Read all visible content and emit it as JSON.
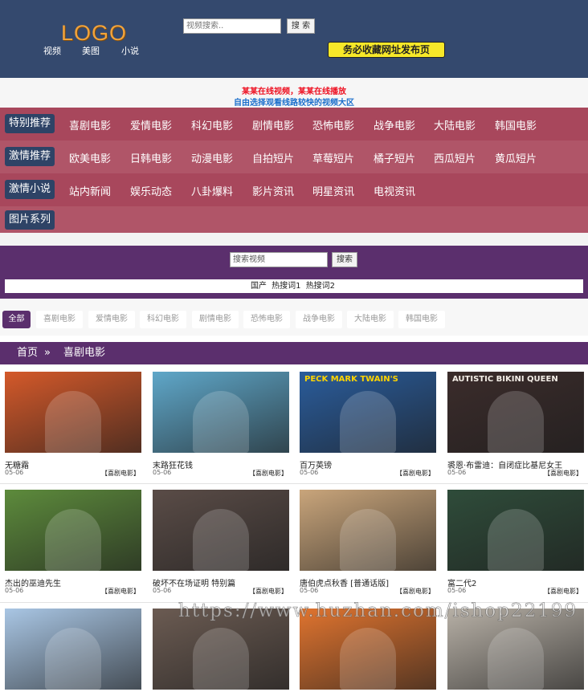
{
  "header": {
    "logo": "LOGO",
    "nav": [
      "视频",
      "美图",
      "小说"
    ],
    "search_placeholder": "视频搜索..",
    "search_button": "搜 索",
    "publish_banner": "务必收藏网址发布页"
  },
  "notice": {
    "line1": "某某在线视频，某某在线播放",
    "line2": "自由选择观看线路较快的视频大区"
  },
  "menu": [
    {
      "head": "特别推荐",
      "items": [
        "喜剧电影",
        "爱情电影",
        "科幻电影",
        "剧情电影",
        "恐怖电影",
        "战争电影",
        "大陆电影",
        "韩国电影"
      ]
    },
    {
      "head": "激情推荐",
      "items": [
        "欧美电影",
        "日韩电影",
        "动漫电影",
        "自拍短片",
        "草莓短片",
        "橘子短片",
        "西瓜短片",
        "黄瓜短片"
      ]
    },
    {
      "head": "激情小说",
      "items": [
        "站内新闻",
        "娱乐动态",
        "八卦爆料",
        "影片资讯",
        "明星资讯",
        "电视资讯"
      ]
    },
    {
      "head": "图片系列",
      "items": []
    }
  ],
  "search2": {
    "placeholder": "搜索视频",
    "button": "搜索",
    "hot": [
      "国产",
      "热搜词1",
      "热搜词2"
    ]
  },
  "filters": {
    "all": "全部",
    "tabs": [
      "喜剧电影",
      "爱情电影",
      "科幻电影",
      "剧情电影",
      "恐怖电影",
      "战争电影",
      "大陆电影",
      "韩国电影"
    ]
  },
  "breadcrumb": {
    "home": "首页",
    "separator": "»",
    "current": "喜剧电影"
  },
  "videos": [
    {
      "title": "无糖霜",
      "date": "05-06",
      "tag": "【喜剧电影】"
    },
    {
      "title": "末路狂花钱",
      "date": "05-06",
      "tag": "【喜剧电影】"
    },
    {
      "title": "百万英镑",
      "date": "05-06",
      "tag": "【喜剧电影】"
    },
    {
      "title": "裘恩·布雷迪：自闭症比基尼女王",
      "date": "05-06",
      "tag": "【喜剧电影】"
    },
    {
      "title": "杰出的巫迪先生",
      "date": "05-06",
      "tag": "【喜剧电影】"
    },
    {
      "title": "破坏不在场证明 特别篇",
      "date": "05-06",
      "tag": "【喜剧电影】"
    },
    {
      "title": "唐伯虎点秋香 [普通话版]",
      "date": "05-06",
      "tag": "【喜剧电影】"
    },
    {
      "title": "富二代2",
      "date": "05-06",
      "tag": "【喜剧电影】"
    },
    {
      "title": "",
      "date": "",
      "tag": ""
    },
    {
      "title": "",
      "date": "",
      "tag": ""
    },
    {
      "title": "",
      "date": "",
      "tag": ""
    },
    {
      "title": "",
      "date": "",
      "tag": ""
    }
  ],
  "posters": [
    {
      "bg": "#d4592a"
    },
    {
      "bg": "#5fa7c9",
      "caption": ""
    },
    {
      "bg": "#2a5c9b",
      "caption": "PECK  MARK TWAIN'S"
    },
    {
      "bg": "#3b2c2b",
      "caption": "AUTISTIC BIKINI QUEEN"
    },
    {
      "bg": "#5d8b3c"
    },
    {
      "bg": "#5a4c47"
    },
    {
      "bg": "#c9a57b"
    },
    {
      "bg": "#2f4c3a"
    },
    {
      "bg": "#a9c6e4"
    },
    {
      "bg": "#6b5b52"
    },
    {
      "bg": "#e0742f"
    },
    {
      "bg": "#b7b0a6"
    }
  ],
  "watermark": "https://www.huzhan.com/ishop22199"
}
